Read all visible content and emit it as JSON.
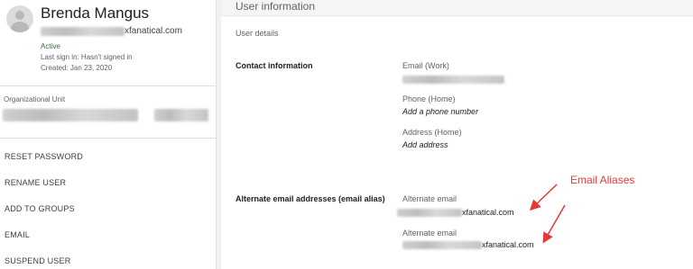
{
  "user": {
    "name": "Brenda Mangus",
    "email_domain": "xfanatical.com",
    "status": "Active",
    "last_sign_in": "Last sign in: Hasn't signed in",
    "created": "Created: Jan 23, 2020"
  },
  "org_unit": {
    "label": "Organizational Unit"
  },
  "menu": [
    {
      "label": "RESET PASSWORD"
    },
    {
      "label": "RENAME USER"
    },
    {
      "label": "ADD TO GROUPS"
    },
    {
      "label": "EMAIL"
    },
    {
      "label": "SUSPEND USER"
    }
  ],
  "panel": {
    "title": "User information",
    "subtitle": "User details",
    "contact": {
      "label": "Contact information",
      "email_label": "Email (Work)",
      "phone_label": "Phone (Home)",
      "phone_value": "Add a phone number",
      "address_label": "Address (Home)",
      "address_value": "Add address"
    },
    "aliases": {
      "label": "Alternate email addresses (email alias)",
      "items": [
        {
          "label": "Alternate email",
          "domain": "xfanatical.com"
        },
        {
          "label": "Alternate email",
          "domain": "xfanatical.com"
        }
      ]
    }
  },
  "annotation": {
    "text": "Email Aliases",
    "color": "#e53935"
  },
  "icons": {
    "avatar": "person-avatar-icon"
  }
}
